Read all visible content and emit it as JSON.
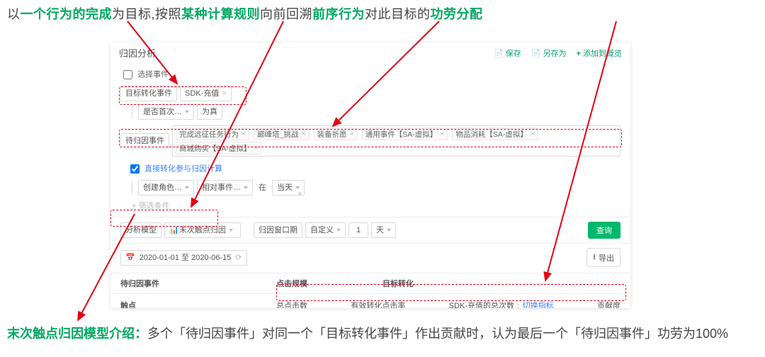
{
  "annotation": {
    "top_parts": [
      {
        "t": "以",
        "g": 0
      },
      {
        "t": "一个行为的完成",
        "g": 1
      },
      {
        "t": "为目标,按照",
        "g": 0
      },
      {
        "t": "某种计算规则",
        "g": 1
      },
      {
        "t": "向前回溯",
        "g": 0
      },
      {
        "t": "前序行为",
        "g": 1
      },
      {
        "t": "对此目标的",
        "g": 0
      },
      {
        "t": "功劳分配",
        "g": 1
      }
    ],
    "bottom_lead": "末次触点归因模型介绍：",
    "bottom_rest": "多个「待归因事件」对同一个「目标转化事件」作出贡献时，认为最后一个「待归因事件」功劳为100%"
  },
  "panel": {
    "title": "归因分析",
    "actions": {
      "save": "保存",
      "save_as": "另存为",
      "add_to_overview": "添加到概览"
    },
    "select_event_label": "选择事件",
    "target_label": "目标转化事件",
    "target_value": "SDK-充值",
    "filter": {
      "field": "是否首次…",
      "op": "为真"
    },
    "attrib_label": "待归因事件",
    "attrib_tags": [
      "完成远征任务行为",
      "巅峰塔_挑战",
      "装备祈愿",
      "通用事件【SA-虚拟】",
      "物品消耗【SA-虚拟】",
      "商城购买【SA-虚拟】"
    ],
    "direct_conv_label": "直接转化参与归因计算",
    "detail": {
      "field1": "创建角色…",
      "field2": "相对事件…",
      "join": "在",
      "val": "当天"
    },
    "add_filter": "+ 筛选条件",
    "model_label": "分析模型",
    "model_value": "末次触点归因",
    "window_label": "归因窗口期",
    "window_mode": "自定义",
    "window_num": "1",
    "window_unit": "天",
    "query": "查询",
    "date_range": "2020-01-01 至 2020-06-15",
    "export": "导出",
    "grid": {
      "h1": "待归因事件",
      "h2": "点击规模",
      "h3": "目标转化",
      "r_label": "触点",
      "c1": "总点击数",
      "c2": "有效转化点击率",
      "c3": "SDK-充值的总次数",
      "switch": "切换指标",
      "c4": "贡献度"
    }
  }
}
